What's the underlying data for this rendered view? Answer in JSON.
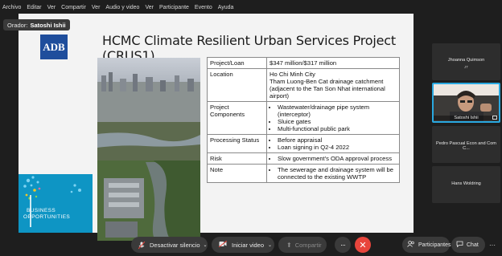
{
  "menu": [
    "Archivo",
    "Editar",
    "Ver",
    "Compartir",
    "Ver",
    "Audio y video",
    "Ver",
    "Participante",
    "Evento",
    "Ayuda"
  ],
  "speaker": {
    "prefix": "Orador:",
    "name": "Satoshi Ishii"
  },
  "slide": {
    "title": "HCMC Climate Resilient Urban Services Project (CRUS1)",
    "logo": "ADB",
    "brand_line1": "BUSINESS",
    "brand_line2": "OPPORTUNITIES",
    "rows": [
      {
        "key": "Project/Loan",
        "value": "$347 million/$317 million"
      },
      {
        "key": "Location",
        "value": "Ho Chi Minh City\nTham Luong-Ben Cat drainage catchment (adjacent to the Tan Son Nhat international airport)"
      },
      {
        "key": "Project Components",
        "bullets": [
          "Wastewater/drainage pipe system (interceptor)",
          "Sluice gates",
          "Multi-functional public park"
        ]
      },
      {
        "key": "Processing Status",
        "bullets": [
          "Before appraisal",
          "Loan signing in Q2-4 2022"
        ]
      },
      {
        "key": "Risk",
        "bullets": [
          "Slow government's ODA approval process"
        ]
      },
      {
        "key": "Note",
        "bullets": [
          "The sewerage and drainage system will be connected to the existing WWTP"
        ]
      }
    ]
  },
  "participants": [
    {
      "name": "Jhoanna Quimson",
      "sub": "JT"
    },
    {
      "name": "Satoshi Ishii",
      "sub": ""
    },
    {
      "name": "Pedro Pascual Econ and Com C...",
      "sub": ""
    },
    {
      "name": "Hans Woldring",
      "sub": ""
    }
  ],
  "controls": {
    "mute": "Desactivar silencio",
    "video": "Iniciar video",
    "share": "Compartir",
    "participants": "Participantes",
    "chat": "Chat"
  },
  "colors": {
    "accent": "#0e95c4",
    "end": "#e8453c",
    "adb": "#1f4e9c"
  }
}
